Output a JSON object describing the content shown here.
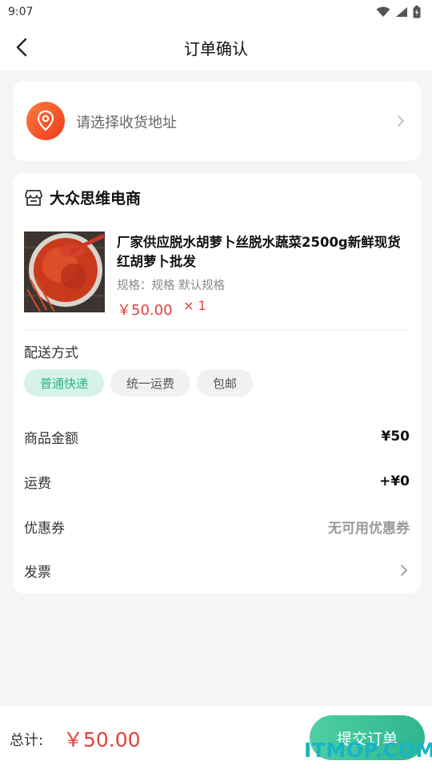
{
  "status_bar": {
    "time": "9:07"
  },
  "nav": {
    "title": "订单确认"
  },
  "address": {
    "placeholder_text": "请选择收货地址"
  },
  "shop": {
    "name": "大众思维电商"
  },
  "product": {
    "title": "厂家供应脱水胡萝卜丝脱水蔬菜2500g新鲜现货红胡萝卜批发",
    "spec": "规格：规格 默认规格",
    "price": "￥50.00",
    "quantity": "× 1"
  },
  "shipping": {
    "label": "配送方式",
    "options": [
      {
        "label": "普通快递",
        "selected": true
      },
      {
        "label": "统一运费",
        "selected": false
      },
      {
        "label": "包邮",
        "selected": false
      }
    ]
  },
  "summary": {
    "goods_amount": {
      "label": "商品金额",
      "value": "¥50"
    },
    "freight": {
      "label": "运费",
      "value": "+¥0"
    },
    "coupon": {
      "label": "优惠券",
      "value": "无可用优惠券"
    },
    "invoice": {
      "label": "发票"
    }
  },
  "footer": {
    "total_label": "总计:",
    "total_value": "￥50.00",
    "submit_label": "提交订单"
  },
  "watermark": {
    "text": "ITMOP.COM"
  },
  "colors": {
    "accent_green": "#2fb58e",
    "price_red": "#e5403a",
    "address_icon_orange": "#f04e23"
  },
  "icons": {
    "back": "chevron-left-icon",
    "address": "location-pin-icon",
    "shop": "store-icon",
    "arrow": "chevron-right-icon"
  }
}
